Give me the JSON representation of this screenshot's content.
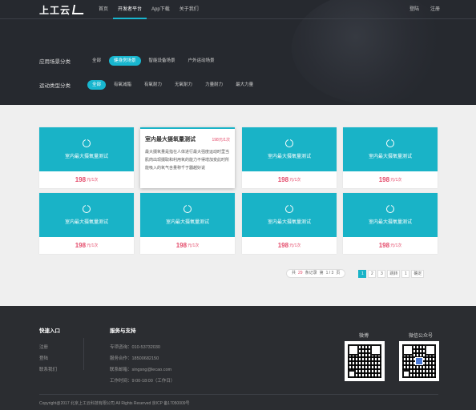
{
  "brand": {
    "logo_text": "上工云"
  },
  "nav": {
    "links": [
      "首页",
      "开发者平台",
      "App下载",
      "关于我们"
    ],
    "active_index": 1,
    "login": "登陆",
    "register": "注册"
  },
  "filters": {
    "scene": {
      "label": "应用场景分类",
      "options": [
        "全部",
        "健身房场景",
        "智能设备场景",
        "户外运动场景"
      ],
      "selected_index": 1
    },
    "sport": {
      "label": "运动类型分类",
      "options": [
        "全部",
        "有氧减脂",
        "有氧耐力",
        "无氧耐力",
        "力量耐力",
        "最大力量"
      ],
      "selected_index": 0
    }
  },
  "cards": [
    {
      "title": "室内最大摄氧量测试",
      "price": "198",
      "unit": "元/1次"
    },
    {
      "title": "室内最大摄氧量测试",
      "price": "198元/1次",
      "unit": "",
      "expanded": true,
      "description": "最大摄氧量是指在人体进行最大强度运动时里当肌肉出现摄取和利用氧的能力不得增加变此时所能吸入的氧气含量称千于器越好说"
    },
    {
      "title": "室内最大摄氧量测试",
      "price": "198",
      "unit": "元/1次"
    },
    {
      "title": "室内最大摄氧量测试",
      "price": "198",
      "unit": "元/1次"
    },
    {
      "title": "室内最大摄氧量测试",
      "price": "198",
      "unit": "元/1次"
    },
    {
      "title": "室内最大摄氧量测试",
      "price": "198",
      "unit": "元/1次"
    },
    {
      "title": "室内最大摄氧量测试",
      "price": "198",
      "unit": "元/1次"
    },
    {
      "title": "室内最大摄氧量测试",
      "price": "198",
      "unit": "元/1次"
    }
  ],
  "pagination": {
    "prefix": "共",
    "total": "29",
    "total_suffix": "条记录",
    "current_label": "第",
    "page_info": "1 / 3",
    "page_suffix": "页",
    "buttons": [
      "1",
      "2",
      "3",
      "跳转",
      "1",
      "确定"
    ],
    "current_index": 0
  },
  "footer": {
    "quick_title": "快速入口",
    "quick_items": [
      "注册",
      "登陆",
      "联系我们"
    ],
    "service_title": "服务与支持",
    "service_items": [
      "专项咨询：010-53732030",
      "服务合作：18500682150",
      "联系邮箱：singsng@lecao.com",
      "工作时间：9:00-18:00（工作日）"
    ],
    "qr_wechat_label": "微博",
    "qr_official_label": "微信公众号",
    "copyright": "Copyright@2017 北京上工云科技有限公司 All Rights Reserved 京ICP 备17050009号"
  }
}
